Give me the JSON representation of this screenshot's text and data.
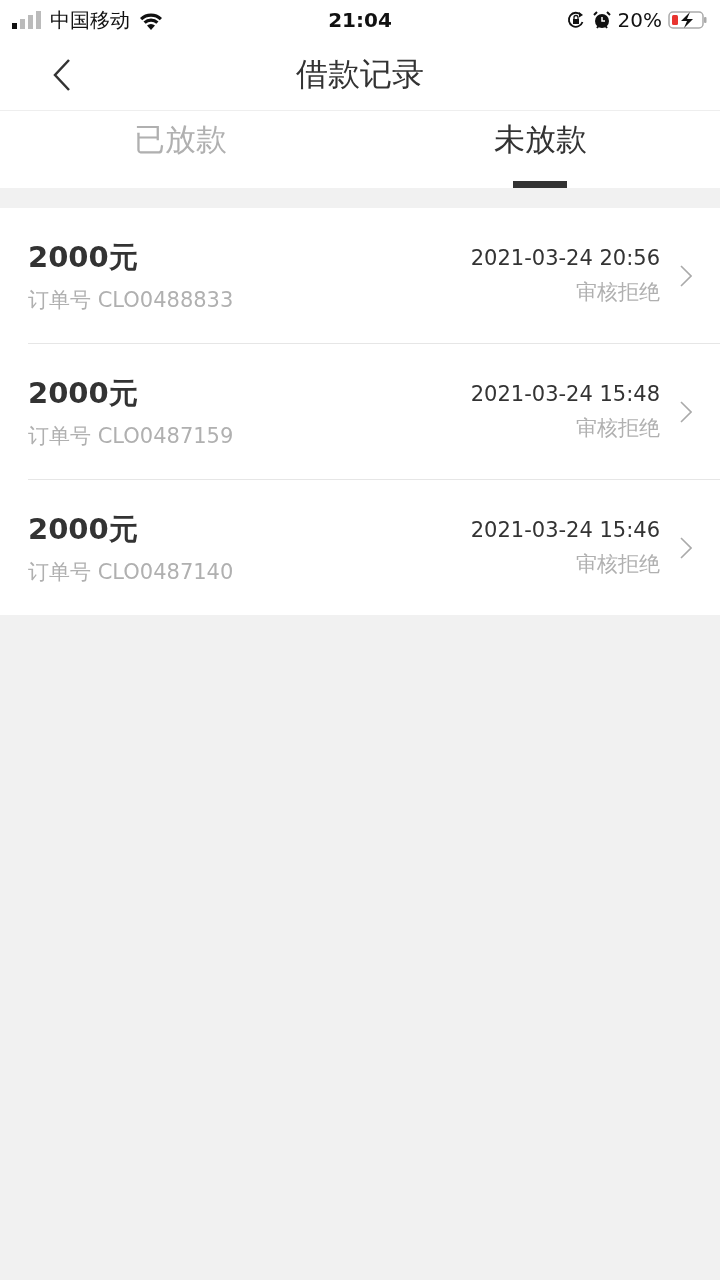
{
  "status_bar": {
    "carrier": "中国移动",
    "time": "21:04",
    "battery_percent": "20%"
  },
  "nav": {
    "title": "借款记录"
  },
  "tabs": [
    {
      "label": "已放款",
      "selected": false
    },
    {
      "label": "未放款",
      "selected": true
    }
  ],
  "records": [
    {
      "amount": "2000元",
      "order": "订单号 CLO0488833",
      "time": "2021-03-24 20:56",
      "status": "审核拒绝"
    },
    {
      "amount": "2000元",
      "order": "订单号 CLO0487159",
      "time": "2021-03-24 15:48",
      "status": "审核拒绝"
    },
    {
      "amount": "2000元",
      "order": "订单号 CLO0487140",
      "time": "2021-03-24 15:46",
      "status": "审核拒绝"
    }
  ]
}
